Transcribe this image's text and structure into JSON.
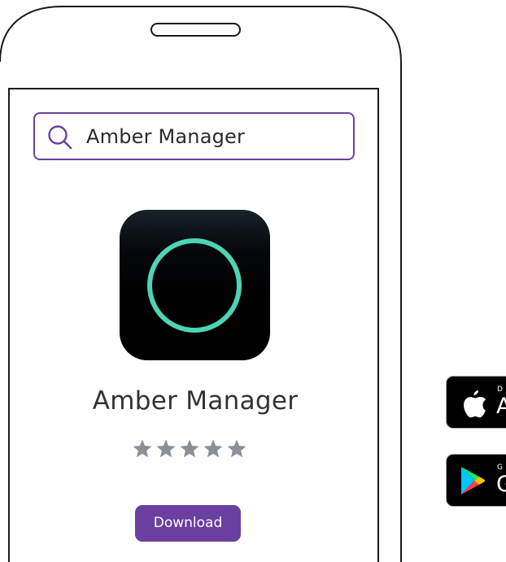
{
  "search": {
    "value": "Amber Manager"
  },
  "app": {
    "name": "Amber Manager",
    "rating": 5,
    "rating_max": 5,
    "download_label": "Download",
    "icon_ring_color": "#4ed4b4",
    "accent_color": "#6a3fa0"
  },
  "badges": {
    "apple": {
      "icon": "apple-icon",
      "small_text": "D",
      "big_text": "A"
    },
    "google": {
      "icon": "google-play-icon",
      "small_text": "G",
      "big_text": "G"
    }
  }
}
